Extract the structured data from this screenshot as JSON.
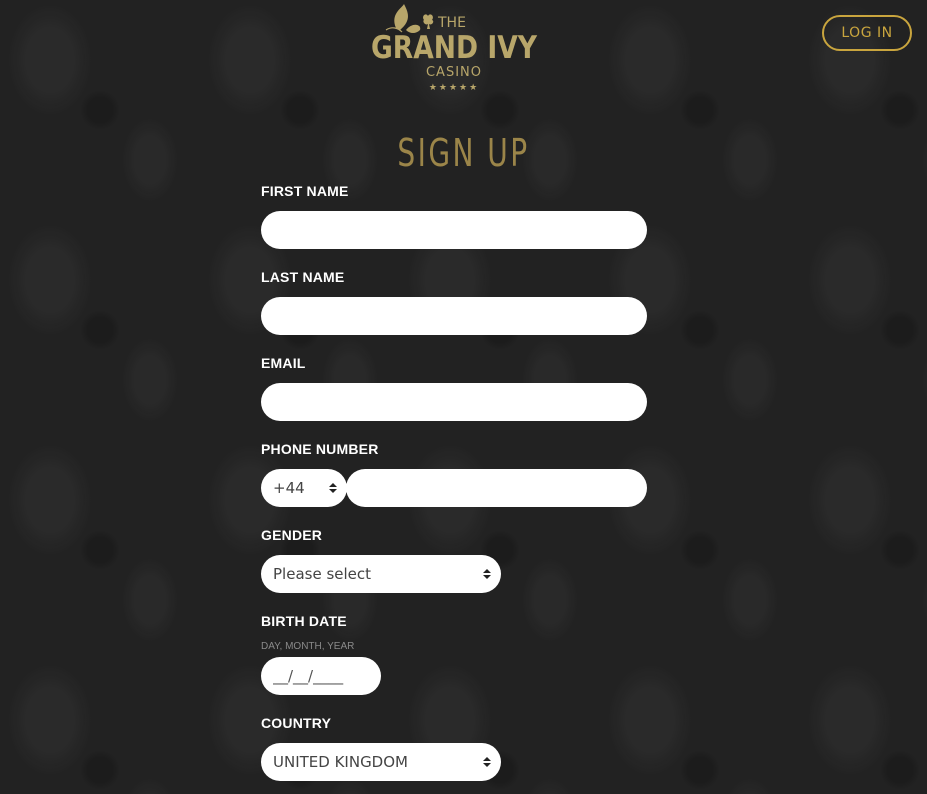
{
  "header": {
    "logo": {
      "the": "THE",
      "name": "GRAND IVY",
      "casino": "CASINO",
      "stars": "★★★★★"
    },
    "login_label": "LOG IN"
  },
  "page_title": "SIGN UP",
  "form": {
    "first_name": {
      "label": "FIRST NAME",
      "value": ""
    },
    "last_name": {
      "label": "LAST NAME",
      "value": ""
    },
    "email": {
      "label": "EMAIL",
      "value": ""
    },
    "phone": {
      "label": "PHONE NUMBER",
      "country_code": "+44",
      "value": ""
    },
    "gender": {
      "label": "GENDER",
      "selected": "Please select"
    },
    "birth_date": {
      "label": "BIRTH DATE",
      "hint": "DAY, MONTH, YEAR",
      "placeholder": "__/__/____"
    },
    "country": {
      "label": "COUNTRY",
      "selected": "UNITED KINGDOM"
    }
  },
  "colors": {
    "gold": "#c9a53e",
    "title_gold": "#9b8549",
    "background": "#222222"
  }
}
